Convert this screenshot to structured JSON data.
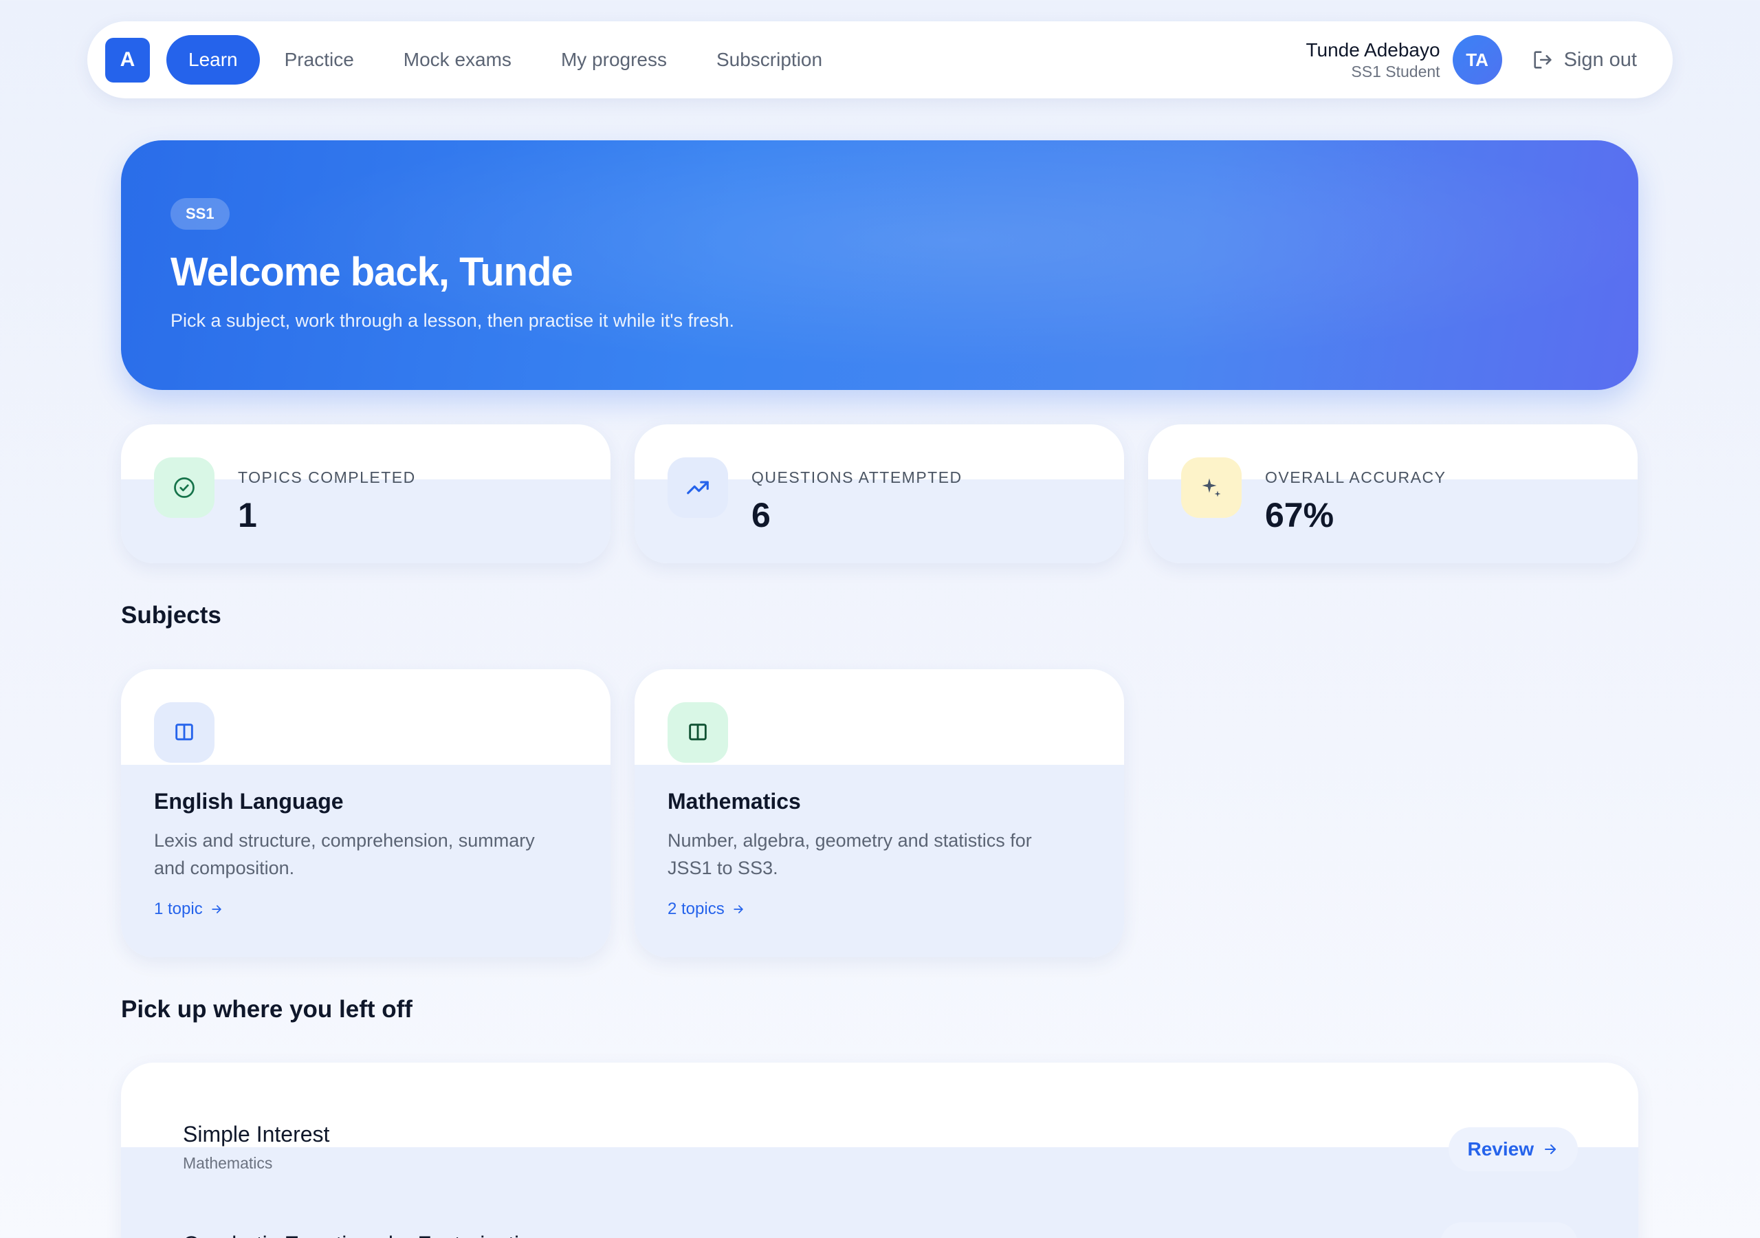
{
  "nav": {
    "logo_letter": "A",
    "links": [
      {
        "label": "Learn"
      },
      {
        "label": "Practice"
      },
      {
        "label": "Mock exams"
      },
      {
        "label": "My progress"
      },
      {
        "label": "Subscription"
      }
    ],
    "active_link": "Learn",
    "user": {
      "name": "Tunde Adebayo",
      "role": "SS1 Student",
      "initials": "TA"
    },
    "sign_out_label": "Sign out"
  },
  "hero": {
    "badge": "SS1",
    "title": "Welcome back, Tunde",
    "subtitle": "Pick a subject, work through a lesson, then practise it while it's fresh."
  },
  "stats": [
    {
      "label": "TOPICS COMPLETED",
      "value": "1",
      "icon": "check-circle-icon",
      "icon_bg": "#d9f7e6",
      "icon_color": "#16734a"
    },
    {
      "label": "QUESTIONS ATTEMPTED",
      "value": "6",
      "icon": "trending-up-icon",
      "icon_bg": "#e3ebfc",
      "icon_color": "#2563eb"
    },
    {
      "label": "OVERALL ACCURACY",
      "value": "67%",
      "icon": "sparkle-icon",
      "icon_bg": "#fdf3c9",
      "icon_color": "#475569"
    }
  ],
  "subjects_section": {
    "title": "Subjects",
    "items": [
      {
        "name": "English Language",
        "description": "Lexis and structure, comprehension, summary and composition.",
        "link": "1 topic",
        "icon_bg": "#e3ebfc",
        "icon_color": "#2563eb"
      },
      {
        "name": "Mathematics",
        "description": "Number, algebra, geometry and statistics for JSS1 to SS3.",
        "link": "2 topics",
        "icon_bg": "#d9f7e6",
        "icon_color": "#0f5132"
      }
    ]
  },
  "resume_section": {
    "title": "Pick up where you left off",
    "items": [
      {
        "title": "Simple Interest",
        "subject": "Mathematics",
        "action": "Review"
      },
      {
        "title": "Quadratic Equations by Factorisation",
        "subject": "",
        "action": ""
      }
    ]
  },
  "colors": {
    "accent": "#2563eb",
    "page_bg": "#ecf1fc"
  }
}
